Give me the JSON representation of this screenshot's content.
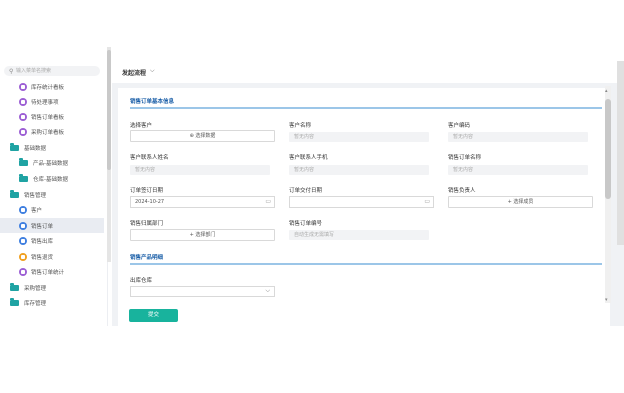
{
  "sidebar": {
    "search_placeholder": "输入菜单名搜索",
    "items": [
      {
        "label": "库存统计看板",
        "type": "circle",
        "color": "#9c5fd4",
        "indent": 1
      },
      {
        "label": "待处理事项",
        "type": "circle",
        "color": "#9c5fd4",
        "indent": 1
      },
      {
        "label": "销售订单看板",
        "type": "circle",
        "color": "#9c5fd4",
        "indent": 1
      },
      {
        "label": "采购订单看板",
        "type": "circle",
        "color": "#9c5fd4",
        "indent": 1
      },
      {
        "label": "基础数据",
        "type": "folder",
        "indent": 0
      },
      {
        "label": "产品-基础数据",
        "type": "folder",
        "indent": 1
      },
      {
        "label": "仓库-基础数据",
        "type": "folder",
        "indent": 1
      },
      {
        "label": "销售管理",
        "type": "folder",
        "indent": 0
      },
      {
        "label": "客户",
        "type": "circle",
        "color": "#3f7fe0",
        "indent": 1
      },
      {
        "label": "销售订单",
        "type": "circle",
        "color": "#3f7fe0",
        "indent": 1,
        "active": true
      },
      {
        "label": "销售出库",
        "type": "circle",
        "color": "#3f7fe0",
        "indent": 1
      },
      {
        "label": "销售退货",
        "type": "circle",
        "color": "#f0a020",
        "indent": 1
      },
      {
        "label": "销售订单统计",
        "type": "circle",
        "color": "#9c5fd4",
        "indent": 1
      },
      {
        "label": "采购管理",
        "type": "folder",
        "indent": 0
      },
      {
        "label": "库存管理",
        "type": "folder",
        "indent": 0
      }
    ]
  },
  "topbar": {
    "title": "发起流程",
    "chevron": "⌵"
  },
  "form": {
    "section1_title": "销售订单基本信息",
    "section2_title": "销售产品明细",
    "customer_label": "选择客户",
    "customer_button": "⊕ 选择数据",
    "customer_name_label": "客户名称",
    "customer_name_value": "暂无内容",
    "customer_code_label": "客户编码",
    "customer_code_value": "暂无内容",
    "contact_name_label": "客户联系人姓名",
    "contact_name_value": "暂无内容",
    "contact_phone_label": "客户联系人手机",
    "contact_phone_value": "暂无内容",
    "order_name_label": "销售订单名称",
    "order_name_value": "暂无内容",
    "sign_date_label": "订单签订日期",
    "sign_date_value": "2024-10-27",
    "delivery_date_label": "订单交付日期",
    "owner_label": "销售负责人",
    "owner_button": "+ 选择成员",
    "dept_label": "销售归属部门",
    "dept_button": "+ 选择部门",
    "order_no_label": "销售订单编号",
    "order_no_placeholder": "自动生成无需填写",
    "warehouse_label": "出库仓库",
    "submit_label": "提交"
  },
  "colors": {
    "accent": "#18b39d",
    "section_title": "#1b5fa8",
    "folder": "#1fa3a3"
  }
}
